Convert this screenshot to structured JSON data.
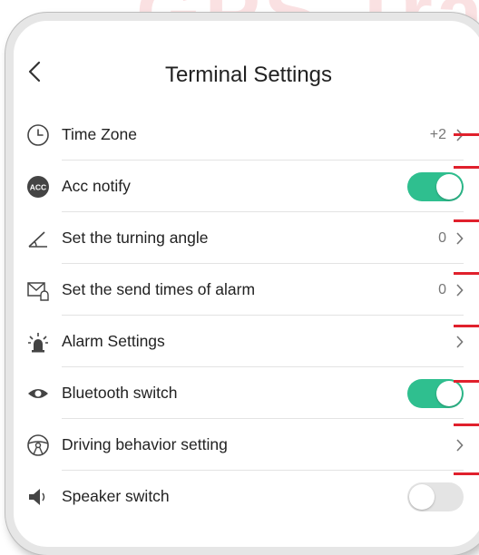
{
  "watermark": "GPS Tra",
  "header": {
    "title": "Terminal Settings",
    "back_icon": "chevron-left-icon"
  },
  "accent_color": "#2fbf8f",
  "marker_color": "#e0202c",
  "settings": [
    {
      "label": "Time Zone",
      "icon": "clock-icon",
      "value": "+2",
      "control": "chevron"
    },
    {
      "label": "Acc notify",
      "icon": "acc-icon",
      "control": "toggle",
      "enabled": true
    },
    {
      "label": "Set the turning angle",
      "icon": "angle-icon",
      "value": "0",
      "control": "chevron"
    },
    {
      "label": "Set the send times of alarm",
      "icon": "mail-alarm-icon",
      "value": "0",
      "control": "chevron"
    },
    {
      "label": "Alarm Settings",
      "icon": "alarm-light-icon",
      "control": "chevron"
    },
    {
      "label": "Bluetooth switch",
      "icon": "eye-icon",
      "control": "toggle",
      "enabled": true
    },
    {
      "label": "Driving behavior setting",
      "icon": "steering-wheel-icon",
      "control": "chevron"
    },
    {
      "label": "Speaker switch",
      "icon": "speaker-icon",
      "control": "toggle",
      "enabled": false
    }
  ]
}
